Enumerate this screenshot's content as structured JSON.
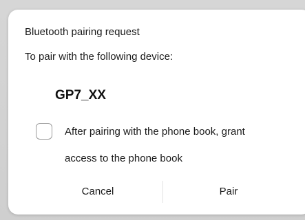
{
  "dialog": {
    "title": "Bluetooth pairing request",
    "message": "To pair with the following device:",
    "device_name": "GP7_XX",
    "checkbox": {
      "checked": false,
      "label_line1": "After pairing with the phone book, grant",
      "label_line2": "access to the phone book"
    },
    "buttons": {
      "cancel_label": "Cancel",
      "pair_label": "Pair"
    }
  },
  "colors": {
    "dialog_background": "#ffffff",
    "backdrop": "#d3d3d3",
    "text": "#1a1a1a",
    "checkbox_border": "#9b9b9b",
    "divider": "#e2e2e2"
  }
}
